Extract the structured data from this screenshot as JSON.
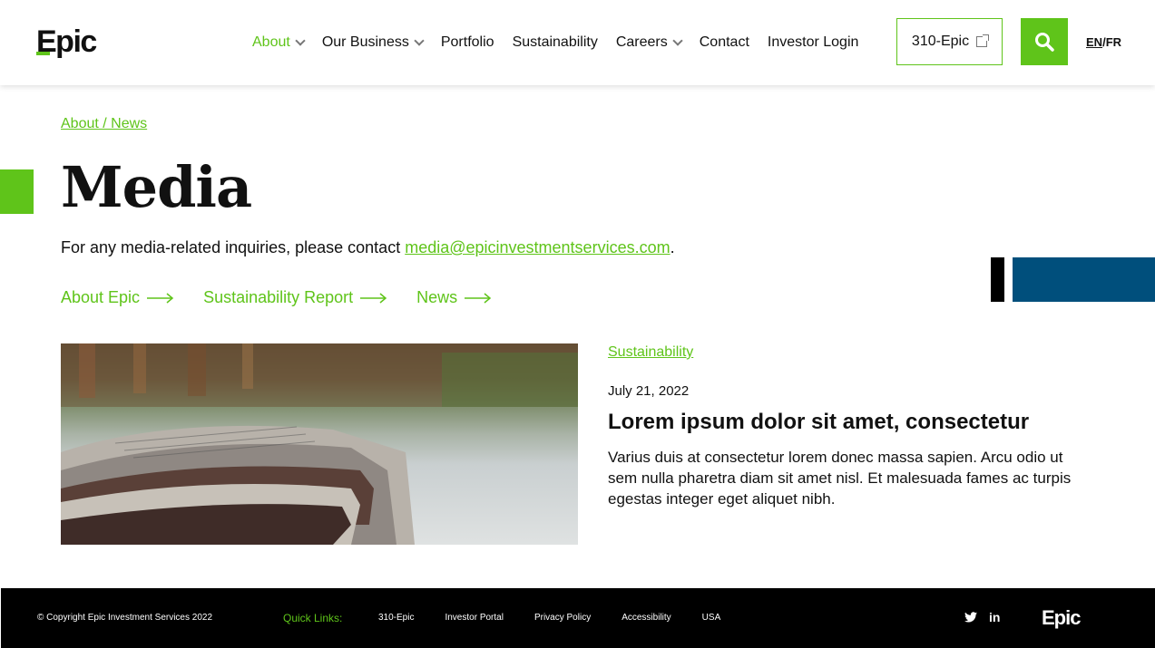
{
  "header": {
    "logo": "Epic",
    "nav": [
      {
        "label": "About",
        "has_dropdown": true,
        "active": true
      },
      {
        "label": "Our Business",
        "has_dropdown": true,
        "active": false
      },
      {
        "label": "Portfolio",
        "has_dropdown": false,
        "active": false
      },
      {
        "label": "Sustainability",
        "has_dropdown": false,
        "active": false
      },
      {
        "label": "Careers",
        "has_dropdown": true,
        "active": false
      },
      {
        "label": "Contact",
        "has_dropdown": false,
        "active": false
      },
      {
        "label": "Investor Login",
        "has_dropdown": false,
        "active": false
      }
    ],
    "ticker_button": "310-Epic",
    "search_icon": "search-icon",
    "lang_en": "EN",
    "lang_sep": "/",
    "lang_fr": "FR"
  },
  "breadcrumb": "About / News",
  "page_title": "Media",
  "intro": {
    "text": "For any media-related inquiries, please contact ",
    "email": "media@epicinvestmentservices.com",
    "suffix": "."
  },
  "quick_links": [
    {
      "label": "About Epic"
    },
    {
      "label": "Sustainability Report"
    },
    {
      "label": "News"
    }
  ],
  "news_item": {
    "category": "Sustainability",
    "date": "July 21, 2022",
    "headline": "Lorem ipsum dolor sit amet, consectetur",
    "excerpt": "Varius duis at consectetur lorem donec massa sapien. Arcu odio ut sem nulla pharetra diam sit amet nisl. Et malesuada fames ac turpis egestas integer eget aliquet nibh."
  },
  "footer": {
    "copyright": "© Copyright Epic Investment Services 2022",
    "quick_links_label": "Quick Links:",
    "links": [
      "310-Epic",
      "Investor Portal",
      "Privacy Policy",
      "Accessibility",
      "USA"
    ],
    "social": [
      "twitter-icon",
      "linkedin-icon"
    ],
    "logo": "Epic"
  },
  "colors": {
    "accent_green": "#5fc41a",
    "deco_blue": "#004f7c",
    "footer_bg": "#000000"
  }
}
